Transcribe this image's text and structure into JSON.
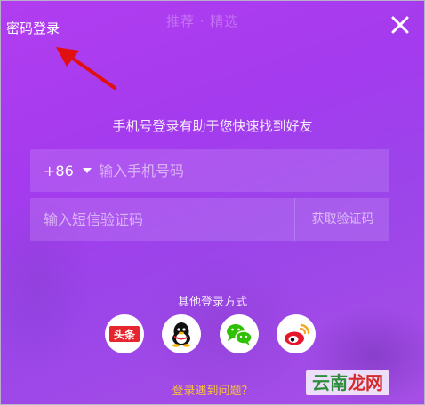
{
  "header": {
    "password_login": "密码登录",
    "background_title": "推荐 · 精选",
    "close_icon": "close-icon"
  },
  "login": {
    "tip": "手机号登录有助于您快速找到好友",
    "country_code": "+86",
    "phone_placeholder": "输入手机号码",
    "code_placeholder": "输入短信验证码",
    "get_code_label": "获取验证码"
  },
  "other_login": {
    "title": "其他登录方式",
    "providers": [
      {
        "name": "toutiao",
        "label": "头条",
        "color": "#e6262e"
      },
      {
        "name": "qq",
        "icon": "qq-icon"
      },
      {
        "name": "wechat",
        "icon": "wechat-icon",
        "color": "#2dc100"
      },
      {
        "name": "weibo",
        "icon": "weibo-icon",
        "color": "#e6162d"
      }
    ]
  },
  "trouble_link": "登录遇到问题？",
  "watermark": {
    "part1": "云南",
    "part2": "龙网"
  },
  "colors": {
    "accent_link": "#f5c23a",
    "annotation_arrow": "#e01010"
  }
}
